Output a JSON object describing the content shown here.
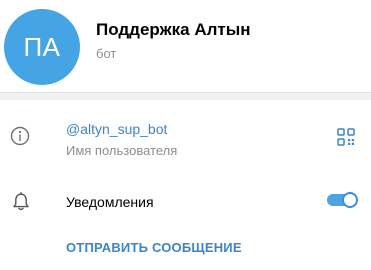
{
  "profile": {
    "avatar_initials": "ПА",
    "avatar_color": "#45a4e4",
    "name": "Поддержка Алтын",
    "status": "бот"
  },
  "info": {
    "icon": "info-icon",
    "username": "@altyn_sup_bot",
    "username_caption": "Имя пользователя",
    "qr_icon": "qr-code-icon"
  },
  "notifications": {
    "icon": "bell-icon",
    "label": "Уведомления",
    "enabled": true
  },
  "actions": {
    "send_message_label": "ОТПРАВИТЬ СООБЩЕНИЕ"
  },
  "colors": {
    "accent": "#3c85c8",
    "secondary_text": "#8e8e93"
  }
}
